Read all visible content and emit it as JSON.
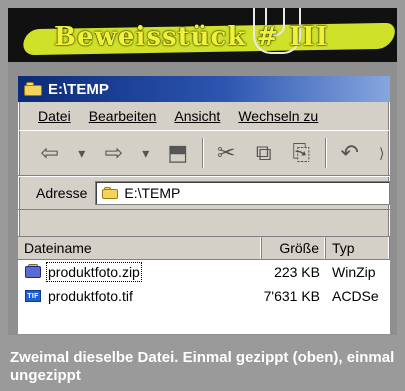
{
  "banner": {
    "title": "Beweisstück # III"
  },
  "window": {
    "title": "E:\\TEMP",
    "menu": [
      {
        "label": "Datei"
      },
      {
        "label": "Bearbeiten"
      },
      {
        "label": "Ansicht"
      },
      {
        "label": "Wechseln zu"
      }
    ],
    "toolbar": {
      "icons": [
        {
          "name": "back-icon",
          "glyph": "⇦"
        },
        {
          "name": "dropdown-icon",
          "glyph": "▾"
        },
        {
          "name": "forward-icon",
          "glyph": "⇨"
        },
        {
          "name": "dropdown-icon",
          "glyph": "▾"
        },
        {
          "name": "up-folder-icon",
          "glyph": "⬒"
        },
        {
          "name": "separator",
          "glyph": ""
        },
        {
          "name": "cut-icon",
          "glyph": "✂"
        },
        {
          "name": "copy-icon",
          "glyph": "⧉"
        },
        {
          "name": "paste-icon",
          "glyph": "⎘"
        },
        {
          "name": "separator",
          "glyph": ""
        },
        {
          "name": "undo-icon",
          "glyph": "↶"
        },
        {
          "name": "more-icon",
          "glyph": "⟩"
        }
      ]
    },
    "address": {
      "label": "Adresse",
      "value": "E:\\TEMP"
    },
    "files": {
      "headers": {
        "name": "Dateiname",
        "size": "Größe",
        "type": "Typ"
      },
      "rows": [
        {
          "name": "produktfoto.zip",
          "size": "223 KB",
          "type": "WinZip",
          "icon": "zip-file-icon",
          "selected": true
        },
        {
          "name": "produktfoto.tif",
          "size": "7'631 KB",
          "type": "ACDSe",
          "icon": "tif-file-icon",
          "selected": false
        }
      ]
    }
  },
  "caption": {
    "text": "Zweimal dieselbe Datei. Einmal gezippt (oben), einmal ungezippt"
  }
}
